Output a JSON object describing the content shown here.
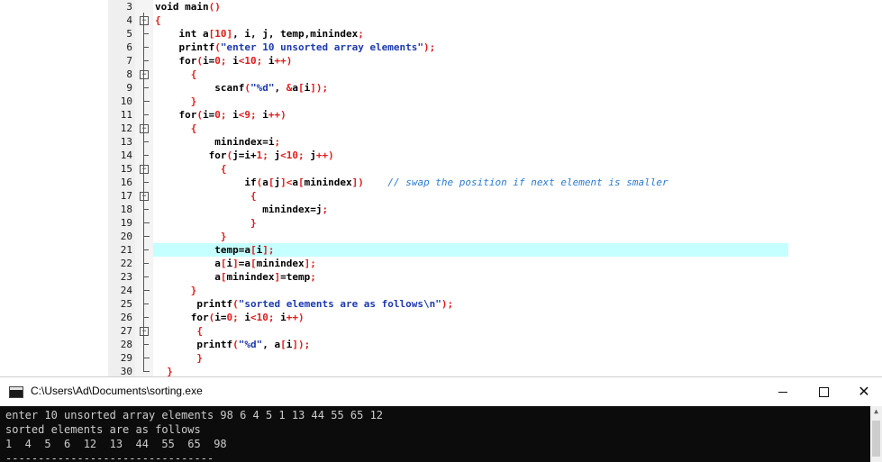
{
  "editor": {
    "highlighted_line": "21",
    "lines": [
      {
        "no": "3",
        "fold": "",
        "code": "<span class=\"k\">void main</span><span class=\"r\">()</span>"
      },
      {
        "no": "4",
        "fold": "minus",
        "code": "<span class=\"r\">{</span>"
      },
      {
        "no": "5",
        "fold": "line",
        "code": "    <span class=\"k\">int</span> <span class=\"k\">a</span><span class=\"r\">[10]</span>, <span class=\"k\">i</span>, <span class=\"k\">j</span>, <span class=\"k\">temp</span>,<span class=\"k\">minindex</span><span class=\"r\">;</span>"
      },
      {
        "no": "6",
        "fold": "line",
        "code": "    <span class=\"k\">printf</span><span class=\"r\">(</span><span class=\"s\">\"enter 10 unsorted array elements\"</span><span class=\"r\">);</span>"
      },
      {
        "no": "7",
        "fold": "line",
        "code": "    <span class=\"k\">for</span><span class=\"r\">(</span>i=<span class=\"r\">0;</span> i<span class=\"r\">&lt;10;</span> i<span class=\"r\">++)</span>"
      },
      {
        "no": "8",
        "fold": "minus",
        "code": "      <span class=\"r\">{</span>"
      },
      {
        "no": "9",
        "fold": "line",
        "code": "          <span class=\"k\">scanf</span><span class=\"r\">(</span><span class=\"s\">\"%d\"</span>, <span class=\"r\">&amp;</span>a<span class=\"r\">[</span>i<span class=\"r\">]);</span>"
      },
      {
        "no": "10",
        "fold": "end",
        "code": "      <span class=\"r\">}</span>"
      },
      {
        "no": "11",
        "fold": "line",
        "code": "    <span class=\"k\">for</span><span class=\"r\">(</span>i=<span class=\"r\">0;</span> i<span class=\"r\">&lt;9;</span> i<span class=\"r\">++)</span>"
      },
      {
        "no": "12",
        "fold": "minus",
        "code": "      <span class=\"r\">{</span>"
      },
      {
        "no": "13",
        "fold": "line",
        "code": "          <span class=\"k\">minindex</span>=i<span class=\"r\">;</span>"
      },
      {
        "no": "14",
        "fold": "line",
        "code": "         <span class=\"k\">for</span><span class=\"r\">(</span>j=i+<span class=\"r\">1;</span> j<span class=\"r\">&lt;10;</span> j<span class=\"r\">++)</span>"
      },
      {
        "no": "15",
        "fold": "minus",
        "code": "           <span class=\"r\">{</span>"
      },
      {
        "no": "16",
        "fold": "line",
        "code": "               <span class=\"k\">if</span><span class=\"r\">(</span>a<span class=\"r\">[</span>j<span class=\"r\">]&lt;</span>a<span class=\"r\">[</span>minindex<span class=\"r\">])</span>    <span class=\"c\">// swap the position if next element is smaller</span>"
      },
      {
        "no": "17",
        "fold": "minus",
        "code": "                <span class=\"r\">{</span>"
      },
      {
        "no": "18",
        "fold": "line",
        "code": "                  <span class=\"k\">minindex</span>=j<span class=\"r\">;</span>"
      },
      {
        "no": "19",
        "fold": "end",
        "code": "                <span class=\"r\">}</span>"
      },
      {
        "no": "20",
        "fold": "end",
        "code": "           <span class=\"r\">}</span>"
      },
      {
        "no": "21",
        "fold": "line",
        "code": "          <span class=\"k\">temp</span>=a<span class=\"r\">[</span>i<span class=\"r\">];</span>"
      },
      {
        "no": "22",
        "fold": "line",
        "code": "          a<span class=\"r\">[</span>i<span class=\"r\">]</span>=a<span class=\"r\">[</span>minindex<span class=\"r\">];</span>"
      },
      {
        "no": "23",
        "fold": "line",
        "code": "          a<span class=\"r\">[</span>minindex<span class=\"r\">]</span>=temp<span class=\"r\">;</span>"
      },
      {
        "no": "24",
        "fold": "end",
        "code": "      <span class=\"r\">}</span>"
      },
      {
        "no": "25",
        "fold": "line",
        "code": "       <span class=\"k\">printf</span><span class=\"r\">(</span><span class=\"s\">\"sorted elements are as follows\\n\"</span><span class=\"r\">);</span>"
      },
      {
        "no": "26",
        "fold": "line",
        "code": "      <span class=\"k\">for</span><span class=\"r\">(</span>i=<span class=\"r\">0;</span> i<span class=\"r\">&lt;10;</span> i<span class=\"r\">++)</span>"
      },
      {
        "no": "27",
        "fold": "minus",
        "code": "       <span class=\"r\">{</span>"
      },
      {
        "no": "28",
        "fold": "line",
        "code": "       <span class=\"k\">printf</span><span class=\"r\">(</span><span class=\"s\">\"%d\"</span>, a<span class=\"r\">[</span>i<span class=\"r\">]);</span>"
      },
      {
        "no": "29",
        "fold": "end",
        "code": "       <span class=\"r\">}</span>"
      },
      {
        "no": "30",
        "fold": "end",
        "code": "  <span class=\"r\">}</span>"
      }
    ]
  },
  "console": {
    "title": "C:\\Users\\Ad\\Documents\\sorting.exe",
    "minimize_glyph": "",
    "maximize_glyph": "",
    "close_glyph": "✕",
    "scroll_up_glyph": "▲",
    "output": [
      "enter 10 unsorted array elements 98 6 4 5 1 13 44 55 65 12",
      "sorted elements are as follows",
      "1  4  5  6  12  13  44  55  65  98",
      "--------------------------------"
    ]
  }
}
